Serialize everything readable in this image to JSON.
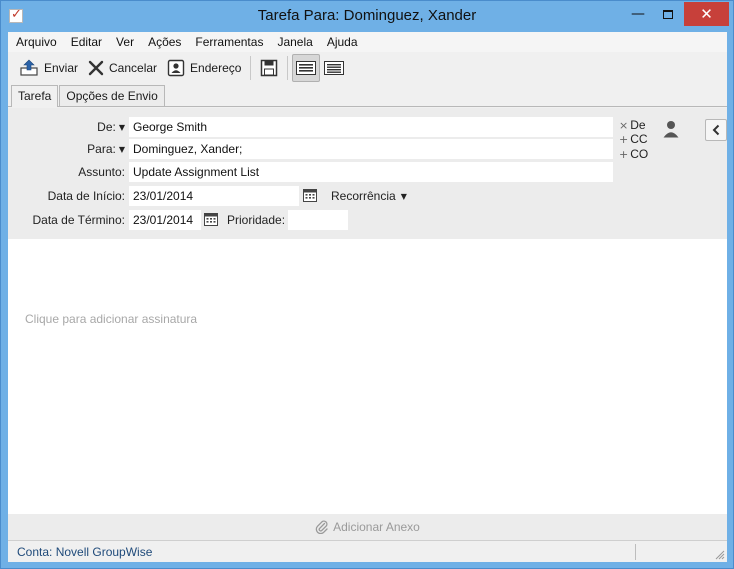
{
  "window": {
    "title": "Tarefa Para: Dominguez, Xander",
    "minimize": "—",
    "close": "✕"
  },
  "menu": [
    "Arquivo",
    "Editar",
    "Ver",
    "Ações",
    "Ferramentas",
    "Janela",
    "Ajuda"
  ],
  "toolbar": {
    "send_label": "Enviar",
    "cancel_label": "Cancelar",
    "address_label": "Endereço"
  },
  "tabs": [
    "Tarefa",
    "Opções de Envio"
  ],
  "form": {
    "from_label": "De:",
    "from_value": "George Smith",
    "to_label": "Para:",
    "to_value": "Dominguez, Xander;",
    "subject_label": "Assunto:",
    "subject_value": "Update Assignment List",
    "start_label": "Data de Início:",
    "start_value": "23/01/2014",
    "recurrence_label": "Recorrência",
    "end_label": "Data de Término:",
    "end_value": "23/01/2014",
    "priority_label": "Prioridade:",
    "priority_value": ""
  },
  "recipients": {
    "from": {
      "symbol": "×",
      "label": "De"
    },
    "cc": {
      "symbol": "+",
      "label": "CC"
    },
    "bcc": {
      "symbol": "+",
      "label": "CO"
    }
  },
  "body": {
    "signature_placeholder": "Clique para adicionar assinatura"
  },
  "attach_label": "Adicionar Anexo",
  "status": {
    "account": "Conta: Novell GroupWise"
  },
  "colors": {
    "titlebar": "#6fb0e6",
    "close_button": "#c7403a",
    "status_text": "#1f4a7a"
  }
}
